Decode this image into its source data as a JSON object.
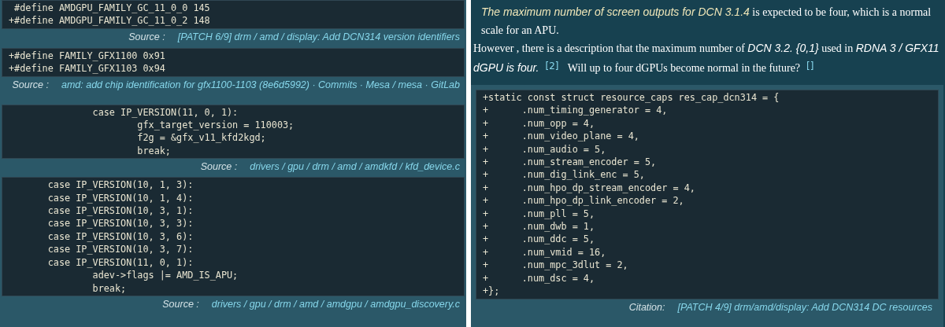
{
  "left_panel": {
    "sections": [
      {
        "code": [
          " #define AMDGPU_FAMILY_GC_11_0_0 145",
          "+#define AMDGPU_FAMILY_GC_11_0_2 148"
        ],
        "source_label": "Source :",
        "source_link": "[PATCH 6/9] drm / amd / display: Add DCN314 version identifiers"
      },
      {
        "code": [
          "+#define FAMILY_GFX1100 0x91",
          "+#define FAMILY_GFX1103 0x94"
        ],
        "source_label": "Source :",
        "source_link": "amd: add chip identification for gfx1100-1103 (8e6d5992) · Commits · Mesa / mesa · GitLab"
      },
      {
        "code": [
          "               case IP_VERSION(11, 0, 1):",
          "                       gfx_target_version = 110003;",
          "                       f2g = &gfx_v11_kfd2kgd;",
          "                       break;"
        ],
        "source_label": "Source :",
        "source_link": "drivers / gpu / drm / amd / amdkfd / kfd_device.c"
      },
      {
        "code": [
          "       case IP_VERSION(10, 1, 3):",
          "       case IP_VERSION(10, 1, 4):",
          "       case IP_VERSION(10, 3, 1):",
          "       case IP_VERSION(10, 3, 3):",
          "       case IP_VERSION(10, 3, 6):",
          "       case IP_VERSION(10, 3, 7):",
          "       case IP_VERSION(11, 0, 1):",
          "               adev->flags |= AMD_IS_APU;",
          "               break;"
        ],
        "source_label": "Source :",
        "source_link": "drivers / gpu / drm / amd / amdgpu / amdgpu_discovery.c"
      }
    ]
  },
  "right_panel": {
    "paragraphs": [
      [
        {
          "kind": "highlight",
          "text": "The maximum number of screen outputs for DCN 3.1.4"
        },
        {
          "kind": "plain",
          "text": " is expected to be four, which is a normal scale for an APU."
        }
      ],
      [
        {
          "kind": "plain",
          "text": "However , there is a description that the maximum number of "
        },
        {
          "kind": "italic",
          "text": "DCN 3.2. {0,1}"
        },
        {
          "kind": "plain",
          "text": " used in "
        },
        {
          "kind": "italic",
          "text": "RDNA 3 / GFX11 dGPU is four."
        },
        {
          "kind": "ref",
          "text": "[2]"
        },
        {
          "kind": "plain",
          "text": " Will up to four dGPUs become normal in the future?"
        },
        {
          "kind": "ref",
          "text": "[]"
        }
      ]
    ],
    "code": [
      "+static const struct resource_caps res_cap_dcn314 = {",
      "+      .num_timing_generator = 4,",
      "+      .num_opp = 4,",
      "+      .num_video_plane = 4,",
      "+      .num_audio = 5,",
      "+      .num_stream_encoder = 5,",
      "+      .num_dig_link_enc = 5,",
      "+      .num_hpo_dp_stream_encoder = 4,",
      "+      .num_hpo_dp_link_encoder = 2,",
      "+      .num_pll = 5,",
      "+      .num_dwb = 1,",
      "+      .num_ddc = 5,",
      "+      .num_vmid = 16,",
      "+      .num_mpc_3dlut = 2,",
      "+      .num_dsc = 4,",
      "+};"
    ],
    "citation_label": "Citation:",
    "citation_link": "[PATCH 4/9] drm/amd/display: Add DCN314 DC resources"
  }
}
